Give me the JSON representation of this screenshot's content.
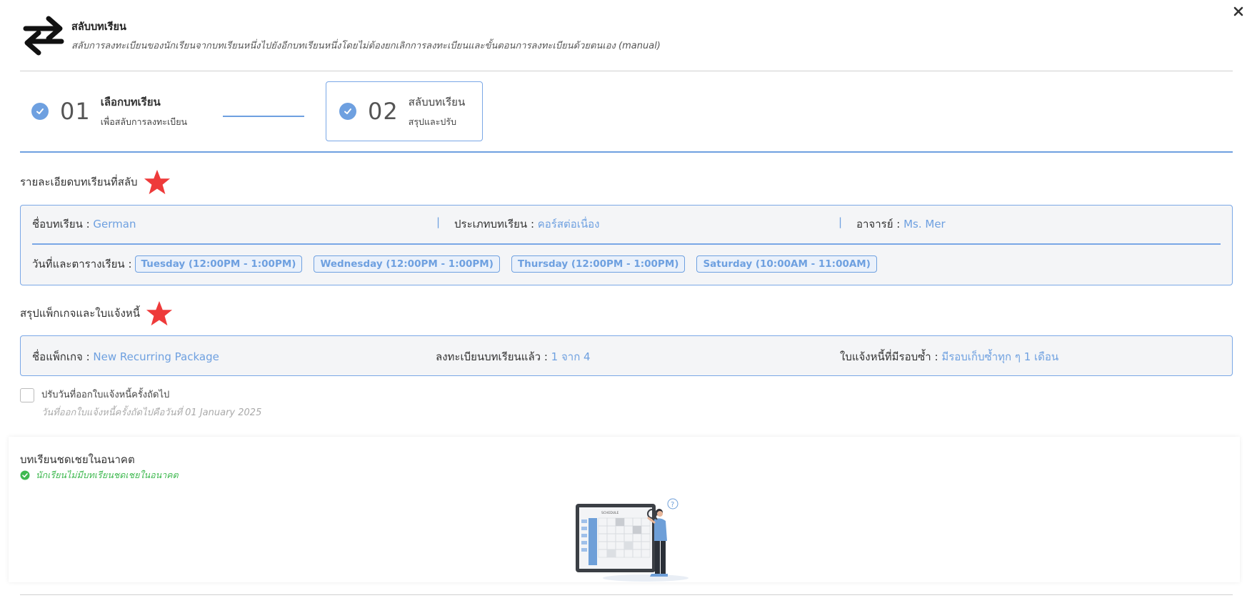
{
  "header": {
    "title": "สลับบทเรียน",
    "subtitle": "สลับการลงทะเบียนของนักเรียนจากบทเรียนหนึ่งไปยังอีกบทเรียนหนึ่งโดยไม่ต้องยกเลิกการลงทะเบียนและขั้นตอนการลงทะเบียนด้วยตนเอง (manual)"
  },
  "stepper": {
    "steps": [
      {
        "number": "01",
        "title": "เลือกบทเรียน",
        "subtitle": "เพื่อสลับการลงทะเบียน"
      },
      {
        "number": "02",
        "title": "สลับบทเรียน",
        "subtitle": "สรุปและปรับ"
      }
    ]
  },
  "lesson_details": {
    "section_title": "รายละเอียดบทเรียนที่สลับ",
    "name_label": "ชื่อบทเรียน : ",
    "name_value": "German",
    "type_label": "ประเภทบทเรียน : ",
    "type_value": "คอร์สต่อเนื่อง",
    "teacher_label": "อาจารย์ : ",
    "teacher_value": "Ms. Mer",
    "separator": "|",
    "schedule_label": "วันที่และตารางเรียน :",
    "schedule": [
      "Tuesday (12:00PM - 1:00PM)",
      "Wednesday (12:00PM - 1:00PM)",
      "Thursday (12:00PM - 1:00PM)",
      "Saturday (10:00AM - 11:00AM)"
    ]
  },
  "package": {
    "section_title": "สรุปแพ็กเกจและใบแจ้งหนี้",
    "name_label": "ชื่อแพ็กเกจ : ",
    "name_value": "New Recurring Package",
    "enrolled_label": "ลงทะเบียนบทเรียนแล้ว : ",
    "enrolled_value": "1 จาก 4",
    "invoice_label": "ใบแจ้งหนี้ที่มีรอบซ้ำ : ",
    "invoice_value": "มีรอบเก็บซ้ำทุก ๆ 1 เดือน"
  },
  "adjust_invoice": {
    "label": "ปรับวันที่ออกใบแจ้งหนี้ครั้งถัดไป",
    "note": "วันที่ออกใบแจ้งหนี้ครั้งถัดไปคือวันที่ 01 January 2025",
    "checked": false
  },
  "future_lessons": {
    "title": "บทเรียนชดเชยในอนาคต",
    "status": "นักเรียนไม่มีบทเรียนชดเชยในอนาคต"
  },
  "illustration": {
    "screen_title": "SCHEDULE"
  },
  "colors": {
    "accent": "#6ea0e0",
    "star": "#ee3a3a",
    "success": "#3fb950",
    "box_bg": "#f4f5f7"
  }
}
